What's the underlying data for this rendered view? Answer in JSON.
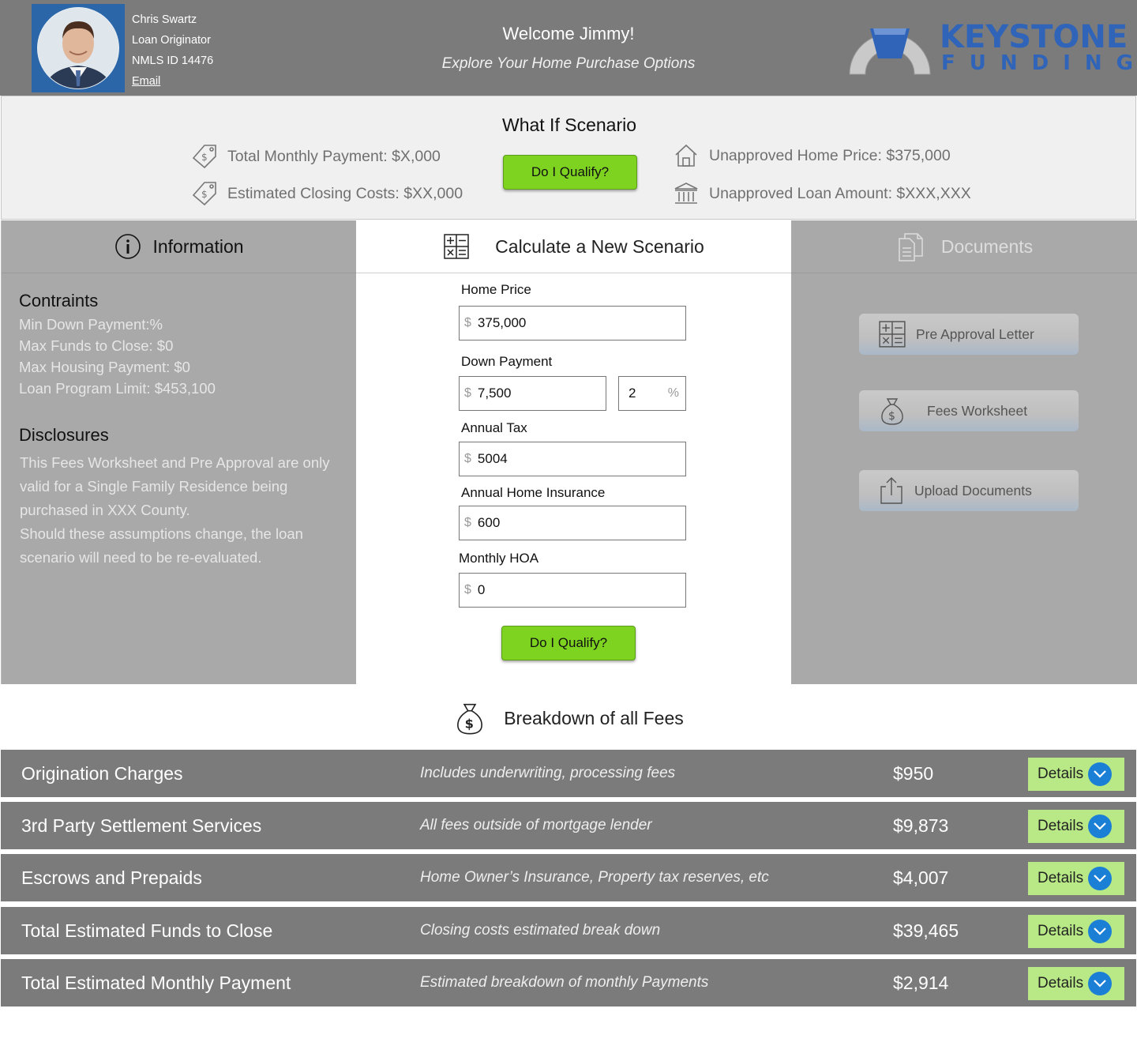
{
  "header": {
    "originator_name": "Chris Swartz",
    "originator_title": "Loan Originator",
    "nmls": "NMLS ID 14476",
    "email_label": "Email",
    "welcome": "Welcome Jimmy!",
    "tagline": "Explore Your Home Purchase Options",
    "logo_line1": "KEYSTONE",
    "logo_line2": "FUNDING"
  },
  "what_if": {
    "title": "What If Scenario",
    "total_monthly_payment": "Total Monthly Payment: $X,000",
    "estimated_closing_costs": "Estimated Closing Costs:  $XX,000",
    "qualify_button": "Do I Qualify?",
    "unapproved_home_price": "Unapproved Home Price: $375,000",
    "unapproved_loan_amount": "Unapproved Loan Amount: $XXX,XXX"
  },
  "information": {
    "tab_label": "Information",
    "constraints_heading": "Contraints",
    "constraints": [
      "Min Down Payment:%",
      "Max Funds to Close: $0",
      "Max Housing Payment: $0",
      "Loan Program Limit: $453,100"
    ],
    "disclosures_heading": "Disclosures",
    "disclosures_text": "This Fees Worksheet and Pre Approval are only valid for a Single Family Residence being purchased in XXX County.",
    "disclosures_text2": "Should these assumptions change, the loan scenario will need to be re-evaluated."
  },
  "calculator": {
    "tab_label": "Calculate a New Scenario",
    "currency_symbol": "$",
    "percent_symbol": "%",
    "home_price_label": "Home Price",
    "home_price_value": "375,000",
    "down_payment_label": "Down Payment",
    "down_payment_value": "7,500",
    "down_payment_percent": "2",
    "annual_tax_label": "Annual Tax",
    "annual_tax_value": "5004",
    "annual_insurance_label": "Annual Home Insurance",
    "annual_insurance_value": "600",
    "monthly_hoa_label": "Monthly HOA",
    "monthly_hoa_value": "0",
    "qualify_button": "Do I Qualify?"
  },
  "documents": {
    "tab_label": "Documents",
    "buttons": [
      "Pre Approval Letter",
      "Fees Worksheet",
      "Upload Documents"
    ]
  },
  "breakdown": {
    "title": "Breakdown of all Fees",
    "details_label": "Details",
    "rows": [
      {
        "name": "Origination Charges",
        "desc": "Includes underwriting, processing fees",
        "amount": "$950"
      },
      {
        "name": "3rd Party Settlement Services",
        "desc": "All fees outside of mortgage lender",
        "amount": "$9,873"
      },
      {
        "name": "Escrows and Prepaids",
        "desc": "Home Owner’s Insurance, Property tax reserves, etc",
        "amount": "$4,007"
      },
      {
        "name": "Total Estimated Funds to Close",
        "desc": "Closing costs estimated break down",
        "amount": "$39,465"
      },
      {
        "name": "Total Estimated Monthly Payment",
        "desc": "Estimated breakdown of monthly Payments",
        "amount": "$2,914"
      }
    ]
  },
  "colors": {
    "header_bg": "#7b7b7b",
    "accent_green": "#7ed321",
    "details_green": "#b8e986",
    "logo_blue": "#2f64b8",
    "chevron_blue": "#1c7fd6"
  },
  "icons": {
    "money_tag": "money-tag-icon",
    "house": "house-icon",
    "bank": "bank-icon",
    "info": "info-icon",
    "calculator": "calculator-icon",
    "documents": "documents-icon",
    "money_bag": "money-bag-icon",
    "upload": "upload-icon",
    "chevron": "chevron-down-icon"
  }
}
